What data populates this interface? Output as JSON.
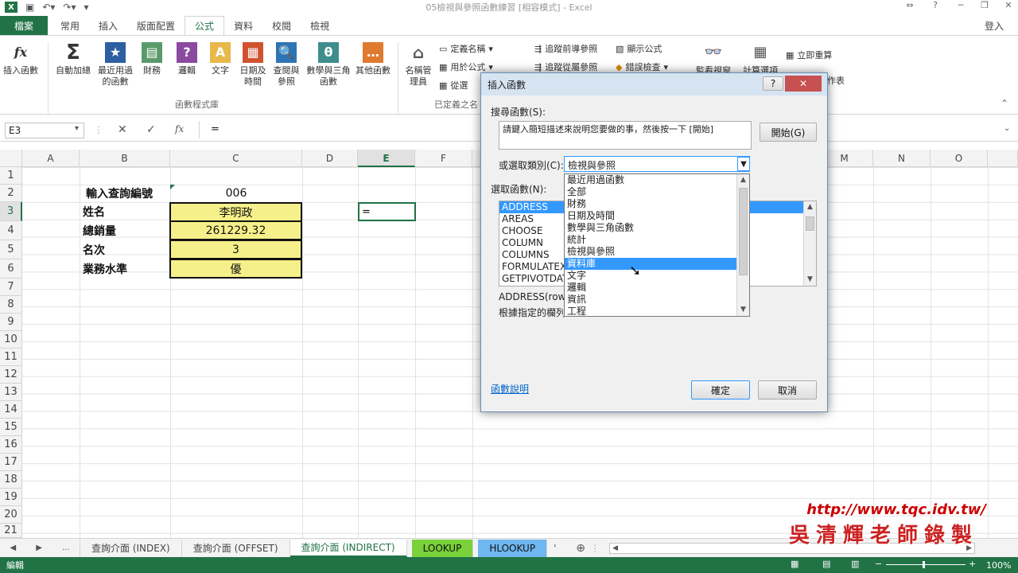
{
  "app": {
    "window_title": "05檢視與參照函數練習 [相容模式] - Excel",
    "login": "登入",
    "logo": "X"
  },
  "ribbon": {
    "file_tab": "檔案",
    "tabs": [
      "常用",
      "插入",
      "版面配置",
      "公式",
      "資料",
      "校閱",
      "檢視"
    ],
    "buttons": [
      {
        "label": "插入函數",
        "icon": "fx-icon"
      },
      {
        "label": "自動加總",
        "icon": "sigma-icon"
      },
      {
        "label": "最近用過的函數",
        "icon": "star-icon"
      },
      {
        "label": "財務",
        "icon": "book-icon"
      },
      {
        "label": "邏輯",
        "icon": "question-book-icon"
      },
      {
        "label": "文字",
        "icon": "text-book-icon"
      },
      {
        "label": "日期及時間",
        "icon": "calendar-icon"
      },
      {
        "label": "查閱與參照",
        "icon": "lookup-book-icon"
      },
      {
        "label": "數學與三角函數",
        "icon": "theta-book-icon"
      },
      {
        "label": "其他函數",
        "icon": "more-book-icon"
      }
    ],
    "group_library": "函數程式庫",
    "name_manager": "名稱管理員",
    "define_name": "定義名稱",
    "use_in_formula": "用於公式",
    "create_from_selection": "從選",
    "group_defined": "已定義之名",
    "trace_precedents": "追蹤前導參照",
    "trace_dependents": "追蹤從屬參照",
    "show_formulas": "顯示公式",
    "error_checking": "錯誤檢查",
    "watch_window": "監看視窗",
    "calc_options": "計算選項",
    "calc_now": "立即重算",
    "calc_sheet": "作表"
  },
  "formula_bar": {
    "name_box": "E3",
    "value": "="
  },
  "grid": {
    "columns": [
      "A",
      "B",
      "C",
      "D",
      "E",
      "F",
      "M",
      "N",
      "O"
    ],
    "rows": [
      "1",
      "2",
      "3",
      "4",
      "5",
      "6",
      "7",
      "8",
      "9",
      "10",
      "11",
      "12",
      "13",
      "14",
      "15",
      "16",
      "17",
      "18",
      "19",
      "20",
      "21"
    ],
    "cells": {
      "B2": "輸入查詢編號",
      "C2": "006",
      "B3": "姓名",
      "C3": "李明政",
      "B4": "總銷量",
      "C4": "261229.32",
      "B5": "名次",
      "C5": "3",
      "B6": "業務水準",
      "C6": "優",
      "E3": "="
    }
  },
  "sheets": {
    "tabs": [
      "查詢介面 (INDEX)",
      "查詢介面 (OFFSET)",
      "查詢介面 (INDIRECT)",
      "LOOKUP",
      "HLOOKUP"
    ],
    "active": "查詢介面 (INDIRECT)",
    "ellipsis": "..."
  },
  "status": {
    "mode": "編輯",
    "zoom": "100%"
  },
  "dialog": {
    "title": "插入函數",
    "search_label": "搜尋函數(S):",
    "search_text": "請鍵入簡短描述來說明您要做的事，然後按一下 [開始]",
    "go_button": "開始(G)",
    "category_label": "或選取類別(C):",
    "category_value": "檢視與參照",
    "category_options": [
      "最近用過函數",
      "全部",
      "財務",
      "日期及時間",
      "數學與三角函數",
      "統計",
      "檢視與參照",
      "資料庫",
      "文字",
      "邏輯",
      "資訊",
      "工程"
    ],
    "category_hover": "資料庫",
    "function_label": "選取函數(N):",
    "functions": [
      "ADDRESS",
      "AREAS",
      "CHOOSE",
      "COLUMN",
      "COLUMNS",
      "FORMULATEXT",
      "GETPIVOTDATA"
    ],
    "selected_function": "ADDRESS",
    "signature": "ADDRESS(row_",
    "description": "根據指定的欄列",
    "help_link": "函數說明",
    "ok_button": "確定",
    "cancel_button": "取消"
  },
  "watermark": {
    "url": "http://www.tqc.idv.tw/",
    "signature": "吳清輝老師錄製"
  }
}
